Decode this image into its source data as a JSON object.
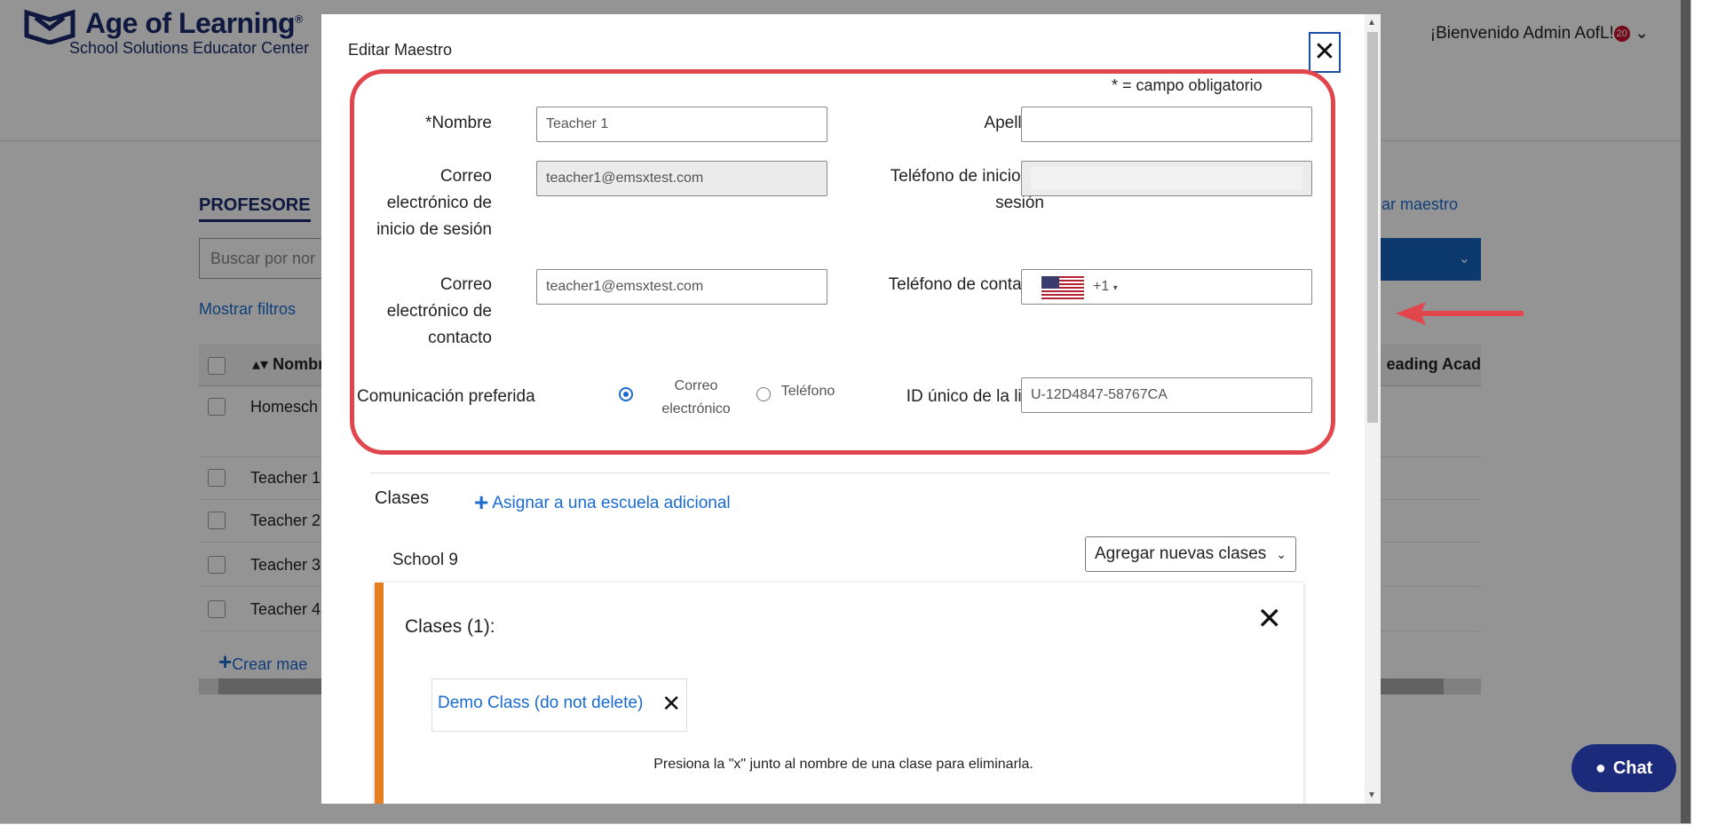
{
  "header": {
    "logo_title": "Age of Learning",
    "logo_reg": "®",
    "logo_subtitle": "School Solutions Educator Center",
    "welcome": "¡Bienvenido Admin AofL!",
    "notification_count": "20"
  },
  "background": {
    "section_title": "PROFESORE",
    "search_placeholder": "Buscar por nor",
    "show_filters": "Mostrar filtros",
    "create_teacher_link": "rear maestro",
    "col_name": "Nombr",
    "col_reading": "eading Acad",
    "rows": [
      "Homesch",
      "Teacher 1",
      "Teacher 2",
      "Teacher 3",
      "Teacher 4"
    ],
    "create_teacher_bottom": "Crear mae"
  },
  "modal": {
    "title": "Editar Maestro",
    "required_note": "* = campo obligatorio",
    "fields": {
      "first_name_label": "*Nombre",
      "first_name_value": "Teacher 1",
      "last_name_label": "Apellido",
      "last_name_value": "",
      "login_email_label": "Correo electrónico de inicio de sesión",
      "login_email_value": "teacher1@emsxtest.com",
      "login_phone_label": "Teléfono de inicio de sesión",
      "login_phone_value": "",
      "contact_email_label": "Correo electrónico de contacto",
      "contact_email_value": "teacher1@emsxtest.com",
      "contact_phone_label": "Teléfono de contacto",
      "contact_phone_code": "+1",
      "preferred_comm_label": "Comunicación preferida",
      "option_email": "Correo electrónico",
      "option_phone": "Teléfono",
      "unique_id_label": "ID único de la lista",
      "unique_id_value": "U-12D4847-58767CA"
    },
    "classes_heading": "Clases",
    "assign_school": "Asignar a una escuela adicional",
    "school_name": "School 9",
    "add_classes_select": "Agregar nuevas clases",
    "card": {
      "title": "Clases (1):",
      "class_chip": "Demo Class (do not delete)",
      "hint": "Presiona la \"x\" junto al nombre de una clase para eliminarla."
    }
  },
  "chat": {
    "label": "Chat"
  },
  "colors": {
    "brand_navy": "#1b2a6b",
    "link_blue": "#1a6bd1",
    "highlight_red": "#e2464d",
    "card_accent": "#e67e22"
  },
  "icons": {
    "close": "close-icon",
    "plus": "plus-icon",
    "chat": "chat-bubble-icon",
    "arrow": "red-arrow-annotation-icon",
    "flag": "us-flag-icon"
  }
}
